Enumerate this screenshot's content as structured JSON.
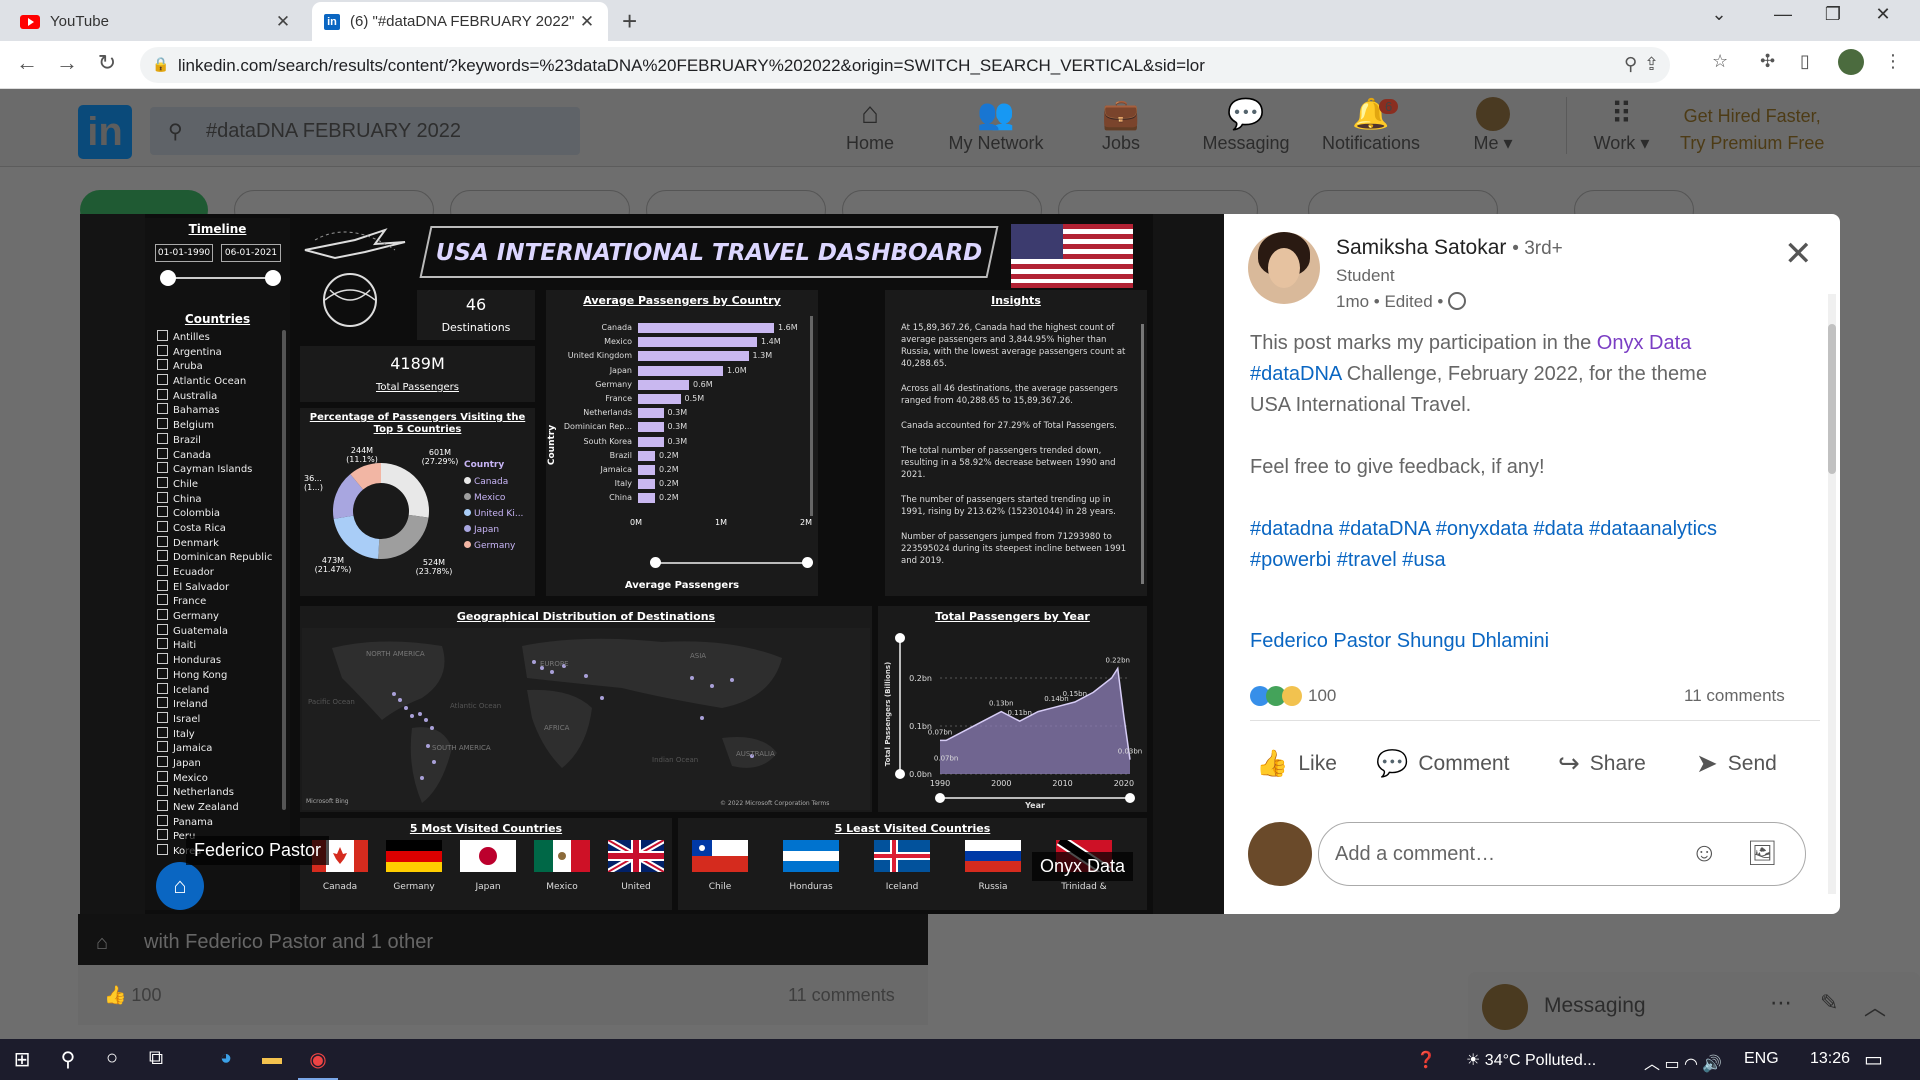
{
  "browser": {
    "tabs": [
      {
        "title": "YouTube",
        "icon": "youtube-icon"
      },
      {
        "title": "(6) \"#dataDNA FEBRUARY 2022\"",
        "icon": "linkedin-icon"
      }
    ],
    "url": "linkedin.com/search/results/content/?keywords=%23dataDNA%20FEBRUARY%202022&origin=SWITCH_SEARCH_VERTICAL&sid=lor"
  },
  "linkedin": {
    "search_value": "#dataDNA FEBRUARY 2022",
    "nav": [
      {
        "label": "Home",
        "icon": "home-icon"
      },
      {
        "label": "My Network",
        "icon": "network-icon"
      },
      {
        "label": "Jobs",
        "icon": "briefcase-icon"
      },
      {
        "label": "Messaging",
        "icon": "chat-icon"
      },
      {
        "label": "Notifications",
        "icon": "bell-icon",
        "badge": "6"
      },
      {
        "label": "Me",
        "icon": "avatar"
      },
      {
        "label": "Work",
        "icon": "grid-icon"
      }
    ],
    "premium_line1": "Get Hired Faster,",
    "premium_line2": "Try Premium Free",
    "bg_reactions": "100",
    "bg_comments": "11 comments",
    "bg_tag_text": "with Federico Pastor and 1 other"
  },
  "dashboard": {
    "title": "USA INTERNATIONAL TRAVEL DASHBOARD",
    "timeline_label": "Timeline",
    "date_from": "01-01-1990",
    "date_to": "06-01-2021",
    "countries_label": "Countries",
    "countries": [
      "Antilles",
      "Argentina",
      "Aruba",
      "Atlantic Ocean",
      "Australia",
      "Bahamas",
      "Belgium",
      "Brazil",
      "Canada",
      "Cayman Islands",
      "Chile",
      "China",
      "Colombia",
      "Costa Rica",
      "Denmark",
      "Dominican Republic",
      "Ecuador",
      "El Salvador",
      "France",
      "Germany",
      "Guatemala",
      "Haiti",
      "Honduras",
      "Hong Kong",
      "Iceland",
      "Ireland",
      "Israel",
      "Italy",
      "Jamaica",
      "Japan",
      "Mexico",
      "Netherlands",
      "New Zealand",
      "Panama",
      "Peru"
    ],
    "country_partial_last": "Korea",
    "destinations_value": "46",
    "destinations_label": "Destinations",
    "total_passengers_value": "4189M",
    "total_passengers_label": "Total Passengers",
    "donut_title": "Percentage of Passengers Visiting the Top 5 Countries",
    "donut_legend_title": "Country",
    "donut_labels": [
      "244M (11.1%)",
      "601M (27.29%)",
      "36... (1...)",
      "473M (21.47%)",
      "524M (23.78%)"
    ],
    "insights_title": "Insights",
    "insights": [
      "At 15,89,367.26, Canada had the highest count of average passengers and 3,844.95% higher than Russia, with the lowest average passengers count at 40,288.65.",
      "Across all 46 destinations, the average passengers ranged from 40,288.65 to 15,89,367.26.",
      "Canada accounted for 27.29% of Total Passengers.",
      "The total number of passengers trended down, resulting in a 58.92% decrease between 1990 and 2021.",
      "The number of passengers started trending up in 1991, rising by 213.62% (152301044) in 28 years.",
      "Number of passengers jumped from 71293980 to 223595024 during its steepest incline between 1991 and 2019."
    ],
    "map_title": "Geographical Distribution of Destinations",
    "map_labels": [
      "NORTH AMERICA",
      "EUROPE",
      "ASIA",
      "AFRICA",
      "SOUTH AMERICA",
      "AUSTRALIA",
      "Pacific Ocean",
      "Atlantic Ocean",
      "Indian Ocean"
    ],
    "map_credit": "© 2022 Microsoft Corporation  Terms",
    "map_brand": "Microsoft Bing",
    "most_title": "5 Most Visited Countries",
    "most": [
      "Canada",
      "Germany",
      "Japan",
      "Mexico",
      "United"
    ],
    "least_title": "5 Least Visited Countries",
    "least": [
      "Chile",
      "Honduras",
      "Iceland",
      "Russia",
      "Trinidad &"
    ],
    "tag_left": "Federico Pastor",
    "tag_right": "Onyx Data"
  },
  "chart_data": [
    {
      "type": "bar",
      "title": "Average Passengers by Country",
      "xlabel": "Average Passengers",
      "ylabel": "Country",
      "categories": [
        "Canada",
        "Mexico",
        "United Kingdom",
        "Japan",
        "Germany",
        "France",
        "Netherlands",
        "Dominican Rep...",
        "South Korea",
        "Brazil",
        "Jamaica",
        "Italy",
        "China"
      ],
      "values": [
        1.6,
        1.4,
        1.3,
        1.0,
        0.6,
        0.5,
        0.3,
        0.3,
        0.3,
        0.2,
        0.2,
        0.2,
        0.2
      ],
      "value_labels": [
        "1.6M",
        "1.4M",
        "1.3M",
        "1.0M",
        "0.6M",
        "0.5M",
        "0.3M",
        "0.3M",
        "0.3M",
        "0.2M",
        "0.2M",
        "0.2M",
        "0.2M"
      ],
      "x_ticks": [
        "0M",
        "1M",
        "2M"
      ],
      "xlim": [
        0,
        2
      ],
      "unit": "M",
      "color": "#c9b8f0"
    },
    {
      "type": "pie",
      "title": "Percentage of Passengers Visiting the Top 5 Countries",
      "categories": [
        "Canada",
        "Mexico",
        "United Ki...",
        "Japan",
        "Germany"
      ],
      "values": [
        601,
        524,
        473,
        366,
        244
      ],
      "colors": [
        "#e8e8e8",
        "#9e9e9e",
        "#a9cdf7",
        "#a8a6e0",
        "#f2b6a4"
      ]
    },
    {
      "type": "area",
      "title": "Total Passengers by Year",
      "xlabel": "Year",
      "ylabel": "Total Passengers (Billions)",
      "x": [
        1990,
        1991,
        1994,
        1997,
        2000,
        2003,
        2006,
        2009,
        2012,
        2015,
        2018,
        2019,
        2020,
        2021
      ],
      "y": [
        0.07,
        0.07,
        0.09,
        0.11,
        0.13,
        0.11,
        0.13,
        0.14,
        0.15,
        0.17,
        0.2,
        0.22,
        0.12,
        0.03
      ],
      "point_labels": [
        "0.07bn",
        "0.07bn",
        "0.13bn",
        "0.11bn",
        "0.14bn",
        "0.15bn",
        "0.22bn",
        "0.03bn"
      ],
      "y_ticks": [
        "0.0bn",
        "0.1bn",
        "0.2bn"
      ],
      "x_ticks": [
        "1990",
        "2000",
        "2010",
        "2020"
      ],
      "ylim": [
        0,
        0.25
      ],
      "color": "#8e7fb8"
    }
  ],
  "post": {
    "author": "Samiksha Satokar",
    "degree": "• 3rd+",
    "headline": "Student",
    "meta": "1mo • Edited •",
    "body1_pre": "This post marks my participation in the ",
    "body1_link": "Onyx Data",
    "body2_tag": "#dataDNA",
    "body2_post": " Challenge, February 2022, for the theme",
    "body3": "USA International Travel.",
    "body4": "Feel free to give feedback, if any!",
    "hashtags1": "#datadna #dataDNA #onyxdata #data #dataanalytics",
    "hashtags2": "#powerbi #travel #usa",
    "mention": "Federico Pastor Shungu Dhlamini",
    "reactions": "100",
    "comments": "11 comments",
    "actions": [
      "Like",
      "Comment",
      "Share",
      "Send"
    ],
    "comment_placeholder": "Add a comment…"
  },
  "messaging_label": "Messaging",
  "taskbar": {
    "weather": "34°C  Polluted...",
    "lang": "ENG",
    "time": "13:26"
  }
}
